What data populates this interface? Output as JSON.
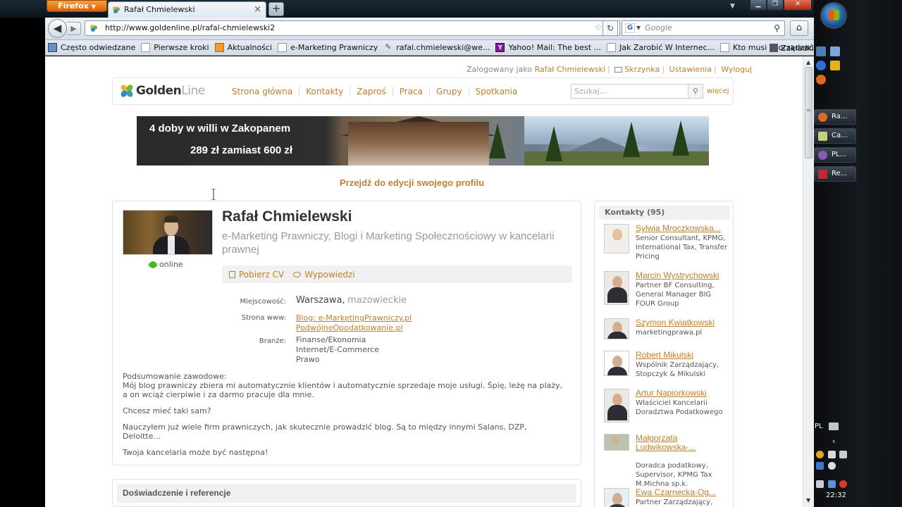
{
  "browser": {
    "app_button": "Firefox",
    "tab_title": "Rafał Chmielewski",
    "url": "http://www.goldenline.pl/rafal-chmielewski2",
    "search_placeholder": "Google",
    "new_tab": "+",
    "bookmarks": [
      {
        "label": "Często odwiedzane",
        "icon": "folder-icon"
      },
      {
        "label": "Pierwsze kroki",
        "icon": "page-icon"
      },
      {
        "label": "Aktualności",
        "icon": "rss-icon"
      },
      {
        "label": "e-Marketing Prawniczy",
        "icon": "page-icon"
      },
      {
        "label": "rafal.chmielewski@we...",
        "icon": "pen-icon"
      },
      {
        "label": "Yahoo! Mail: The best ...",
        "icon": "yahoo-icon"
      },
      {
        "label": "Jak Zarobić W Internec...",
        "icon": "page-icon"
      },
      {
        "label": "Kto musi sporządzać s...",
        "icon": "page-icon"
      }
    ],
    "bookmarks_menu": "Zakładki"
  },
  "site": {
    "logo_golden": "Golden",
    "logo_line": "Line",
    "userbar": {
      "logged_in_text": "Zalogowany jako",
      "user": "Rafał Chmielewski",
      "inbox": "Skrzynka",
      "settings": "Ustawienia",
      "logout": "Wyloguj"
    },
    "nav": [
      "Strona główna",
      "Kontakty",
      "Zaproś",
      "Praca",
      "Grupy",
      "Spotkania"
    ],
    "search_placeholder": "Szukaj...",
    "more": "więcej"
  },
  "banner": {
    "line1": "4 doby w willi w Zakopanem",
    "line2": "289 zł zamiast 600 zł"
  },
  "edit_profile_link": "Przejdź do edycji swojego profilu",
  "profile": {
    "name": "Rafał Chmielewski",
    "tagline": "e-Marketing Prawniczy, Blogi i Marketing Społecznościowy w kancelarii prawnej",
    "status": "online",
    "actions": {
      "cv": "Pobierz CV",
      "statements": "Wypowiedzi"
    },
    "location_label": "Miejscowość:",
    "city": "Warszawa,",
    "region": "mazowieckie",
    "website_label": "Strona www:",
    "websites": [
      "Blog: e-MarketingPrawniczy.pl",
      "PodwójneOpodatkowanie.pl"
    ],
    "industries_label": "Branże:",
    "industries": [
      "Finanse/Ekonomia",
      "Internet/E-Commerce",
      "Prawo"
    ],
    "summary_heading": "Podsumowanie zawodowe:",
    "summary": [
      "Mój blog prawniczy zbiera mi automatycznie klientów i automatycznie sprzedaje moje usługi. Śpię, leżę na plaży, a on wciąż cierpiwie i za darmo pracuje dla mnie.",
      "Chcesz mieć taki sam?",
      "Nauczyłem już wiele firm prawniczych, jak skutecznie prowadzić blog. Są to między innymi Salans, DZP, Deloitte...",
      "Twoja kancelaria może być następna!"
    ],
    "experience_heading": "Doświadczenie i referencje"
  },
  "contacts": {
    "heading": "Kontakty (95)",
    "items": [
      {
        "name": "Sylwia Mroczkowska...",
        "desc": "Senior Consultant, KPMG, International Tax, Transfer Pricing"
      },
      {
        "name": "Marcin Wystrychowski",
        "desc": "Partner BF Consulting, General Manager BIG FOUR Group"
      },
      {
        "name": "Szymon Kwiatkowski",
        "desc": "marketingprawa.pl"
      },
      {
        "name": "Robert Mikulski",
        "desc": "Wspólnik Zarządzający, Stopczyk & Mikulski"
      },
      {
        "name": "Artur Napiorkowski",
        "desc": "Właściciel Kancelarii Doradztwa Podatkowego"
      },
      {
        "name": "Małgorzata Ludwikowska-...",
        "desc": "Doradca podatkowy, Supervisor, KPMG Tax M.Michna sp.k."
      },
      {
        "name": "Ewa Czarnecka-Og...",
        "desc": "Partner Zarządzający,"
      }
    ]
  },
  "taskbar": {
    "items": [
      "Ra...",
      "Ca...",
      "PL...",
      "Re..."
    ],
    "lang": "PL",
    "clock": "22:32"
  }
}
